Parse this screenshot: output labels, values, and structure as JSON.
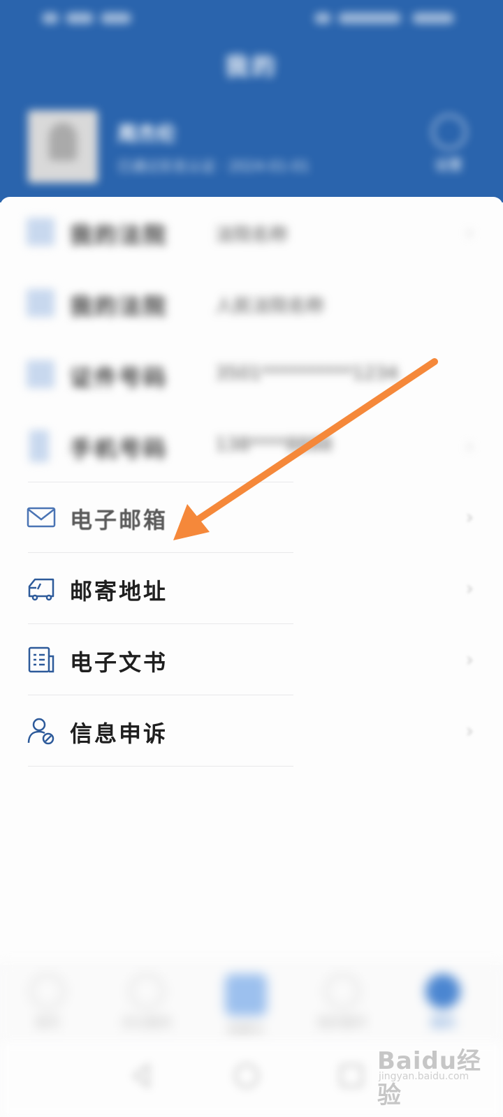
{
  "header": {
    "title": "我的",
    "user_name": "周杰伦",
    "user_sub": "已通过实名认证 · 2024-01-01",
    "settings_label": "设置",
    "background_color": "#2a64ad"
  },
  "menu": {
    "items": [
      {
        "label": "我的法院",
        "value": "法院名称",
        "icon": "building-icon"
      },
      {
        "label": "我的法院",
        "value": "人民法院名称",
        "icon": "court-icon"
      },
      {
        "label": "证件号码",
        "value": "3501**********1234",
        "icon": "id-card-icon"
      },
      {
        "label": "手机号码",
        "value": "138****8888",
        "icon": "phone-icon"
      },
      {
        "label": "电子邮箱",
        "value": "",
        "icon": "mail-icon"
      },
      {
        "label": "邮寄地址",
        "value": "",
        "icon": "truck-icon"
      },
      {
        "label": "电子文书",
        "value": "",
        "icon": "document-icon"
      },
      {
        "label": "信息申诉",
        "value": "",
        "icon": "user-appeal-icon"
      }
    ]
  },
  "bottom_nav": {
    "items": [
      {
        "label": "首页",
        "icon": "home-icon"
      },
      {
        "label": "诉讼服务",
        "icon": "service-icon"
      },
      {
        "label": "我要办",
        "icon": "center-action-icon"
      },
      {
        "label": "我的案件",
        "icon": "case-icon"
      },
      {
        "label": "我的",
        "icon": "profile-icon"
      }
    ],
    "active_color": "#4b86d1"
  },
  "annotation": {
    "arrow_color": "#f5883a"
  },
  "watermark": {
    "text": "Baidu经验",
    "sub": "jingyan.baidu.com"
  }
}
